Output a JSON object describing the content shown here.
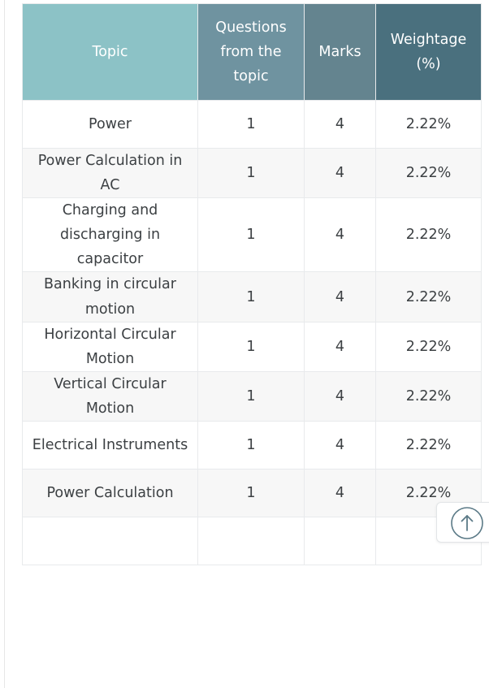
{
  "table": {
    "headers": [
      {
        "label": "Topic",
        "color": "#8cc2c6"
      },
      {
        "label": "Questions from the topic",
        "color": "#6f93a0"
      },
      {
        "label": "Marks",
        "color": "#64848f"
      },
      {
        "label": "Weightage (%)",
        "color": "#4a707e"
      }
    ],
    "rows": [
      {
        "topic": "Power",
        "questions": "1",
        "marks": "4",
        "weightage": "2.22%"
      },
      {
        "topic": "Power Calculation in AC",
        "questions": "1",
        "marks": "4",
        "weightage": "2.22%"
      },
      {
        "topic": "Charging and discharging in capacitor",
        "questions": "1",
        "marks": "4",
        "weightage": "2.22%"
      },
      {
        "topic": "Banking in circular motion",
        "questions": "1",
        "marks": "4",
        "weightage": "2.22%"
      },
      {
        "topic": "Horizontal Circular Motion",
        "questions": "1",
        "marks": "4",
        "weightage": "2.22%"
      },
      {
        "topic": "Vertical Circular Motion",
        "questions": "1",
        "marks": "4",
        "weightage": "2.22%"
      },
      {
        "topic": "Electrical Instruments",
        "questions": "1",
        "marks": "4",
        "weightage": "2.22%"
      },
      {
        "topic": "Power Calculation",
        "questions": "1",
        "marks": "4",
        "weightage": "2.22%"
      },
      {
        "topic": "",
        "questions": "",
        "marks": "",
        "weightage": ""
      }
    ]
  },
  "scroll_top_button": {
    "icon": "arrow-up-in-circle-icon",
    "accent_color": "#5b7a87"
  },
  "theme": {
    "body_text": "#3c4043",
    "row_alt_background": "#f7f7f7",
    "row_background": "#ffffff",
    "cell_border": "#e8eaec"
  }
}
